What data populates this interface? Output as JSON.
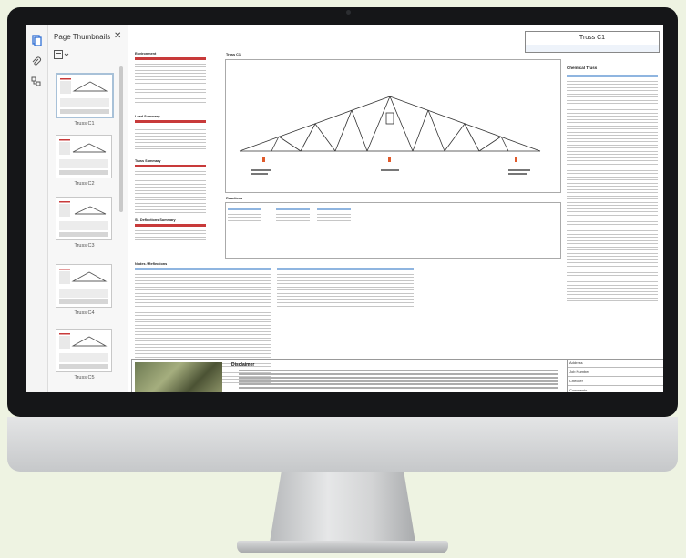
{
  "thumbnail_panel": {
    "title": "Page Thumbnails",
    "close_icon": "close-icon",
    "options_icon": "thumbnail-options-icon",
    "pages": [
      {
        "label": "Truss C1",
        "selected": true
      },
      {
        "label": "Truss C2",
        "selected": false
      },
      {
        "label": "Truss C3",
        "selected": false
      },
      {
        "label": "Truss C4",
        "selected": false
      },
      {
        "label": "Truss C5",
        "selected": false
      }
    ]
  },
  "tool_rail": {
    "icons": [
      "page-thumbnails-icon",
      "attachment-icon",
      "layers-icon"
    ]
  },
  "document": {
    "header_title": "Truss C1",
    "truss_label": "Truss C1",
    "chemical_title": "Chemical Truss",
    "sections": {
      "environment": "Environment",
      "load_summary": "Load Summary",
      "truss_summary": "Truss Summary",
      "deflections": "SL Deflections Summary",
      "reactions": "Reactions",
      "nodes": "Nodes / Reflections"
    },
    "disclaimer_title": "Disclaimer",
    "title_block": {
      "rows": [
        "Address",
        "Job Number",
        "Checker",
        "Comments"
      ]
    }
  },
  "colors": {
    "table_header_red": "#c83a3a",
    "table_header_blue": "#8fb5e0",
    "support_marker": "#e05a2a"
  }
}
